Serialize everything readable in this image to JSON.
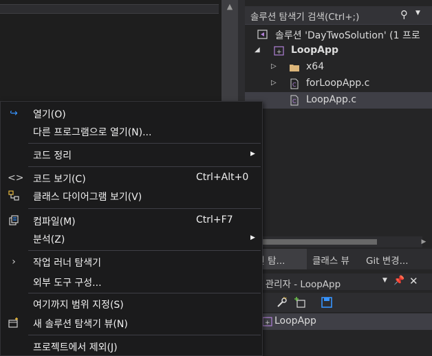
{
  "solution_explorer": {
    "search_label": "솔루션 탐색기 검색(Ctrl+;)",
    "items": [
      {
        "label": "솔루션 'DayTwoSolution' (1 프로"
      },
      {
        "label": "LoopApp"
      },
      {
        "label": "x64"
      },
      {
        "label": "forLoopApp.c"
      },
      {
        "label": "LoopApp.c"
      }
    ]
  },
  "tabs": [
    {
      "label": "루션 탐..."
    },
    {
      "label": "클래스 뷰"
    },
    {
      "label": "Git 변경..."
    }
  ],
  "property_manager": {
    "title": "성 관리자 - LoopApp",
    "item_label": "LoopApp"
  },
  "context_menu": {
    "items": [
      {
        "label": "열기(O)",
        "shortcut": ""
      },
      {
        "label": "다른 프로그램으로 열기(N)...",
        "shortcut": ""
      },
      {
        "label": "코드 정리",
        "shortcut": ""
      },
      {
        "label": "코드 보기(C)",
        "shortcut": "Ctrl+Alt+0"
      },
      {
        "label": "클래스 다이어그램 보기(V)",
        "shortcut": ""
      },
      {
        "label": "컴파일(M)",
        "shortcut": "Ctrl+F7"
      },
      {
        "label": "분석(Z)",
        "shortcut": ""
      },
      {
        "label": "작업 러너 탐색기",
        "shortcut": ""
      },
      {
        "label": "외부 도구 구성...",
        "shortcut": ""
      },
      {
        "label": "여기까지 범위 지정(S)",
        "shortcut": ""
      },
      {
        "label": "새 솔루션 탐색기 뷰(N)",
        "shortcut": ""
      },
      {
        "label": "프로젝트에서 제외(J)",
        "shortcut": ""
      }
    ]
  },
  "colors": {
    "accent": "#0078d4",
    "menu_bg": "#1b1b1c",
    "panel_bg": "#252526"
  }
}
